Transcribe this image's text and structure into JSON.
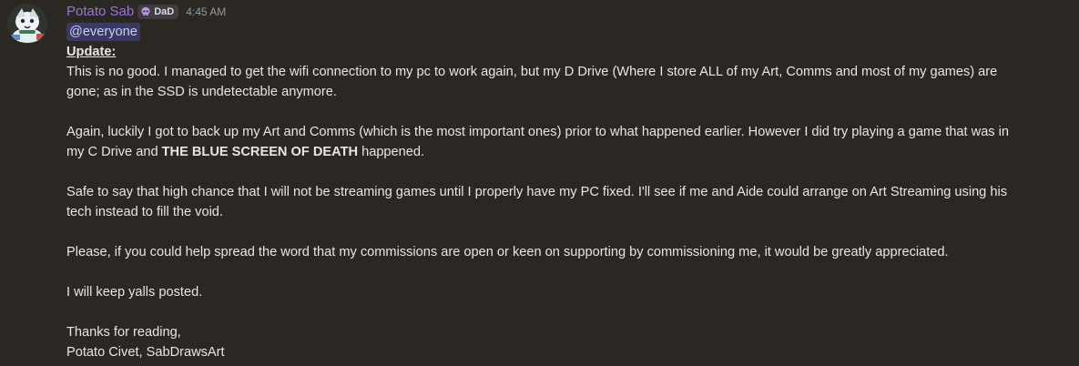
{
  "author": {
    "name": "Potato Sab",
    "tag": "DaD",
    "timestamp": "4:45 AM",
    "avatar_icon": "snowman-avatar-icon",
    "name_color": "#9a73d6"
  },
  "message": {
    "mention": "@everyone",
    "heading": "Update:",
    "p1_line1": "This is no good. I managed to get the wifi connection to my pc to work again, but my D Drive (Where I store ALL of my Art, Comms and most of my games) are",
    "p1_line2": "gone; as in the SSD is undetectable anymore.",
    "p2_line1": "Again, luckily I got to back up my Art and Comms (which is the most important ones) prior to what happened earlier. However I did try playing a game that was in",
    "p2_line2_pre": "my C Drive and ",
    "p2_line2_bold": "THE BLUE SCREEN OF DEATH",
    "p2_line2_post": " happened.",
    "p3_line1": "Safe to say that high chance that I will not be streaming games until I properly have my PC fixed. I'll see if me and Aide could arrange on Art Streaming using his",
    "p3_line2": "tech instead to fill the void.",
    "p4_line1": "Please, if you could help spread the word that my commissions are open or keen on supporting by commissioning me, it would be greatly appreciated.",
    "p5_line1": "I will keep yalls posted.",
    "sign1": "Thanks for reading,",
    "sign2": "Potato Civet, SabDrawsArt"
  }
}
